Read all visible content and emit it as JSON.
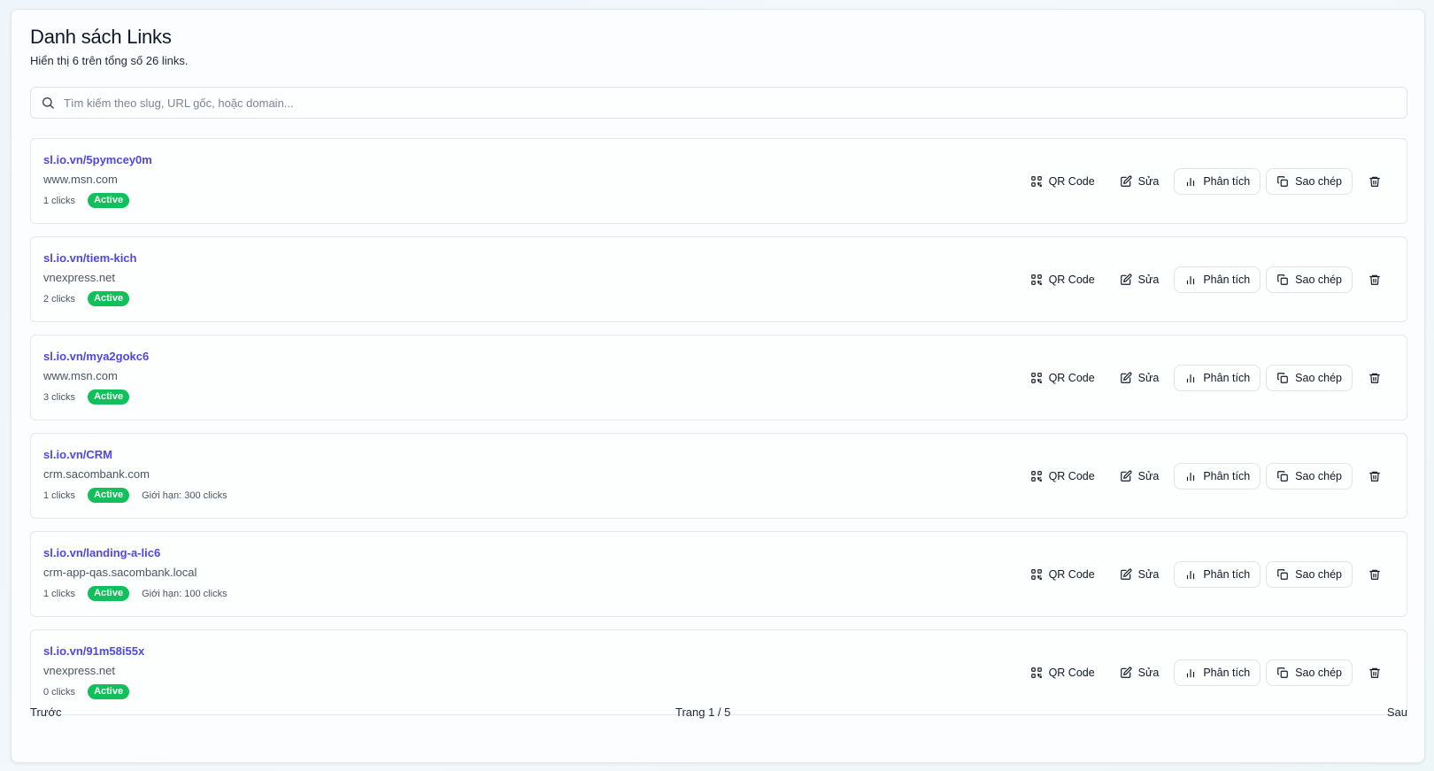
{
  "header": {
    "title": "Danh sách Links",
    "subtitle": "Hiển thị 6 trên tổng số 26 links."
  },
  "search": {
    "placeholder": "Tìm kiếm theo slug, URL gốc, hoặc domain...",
    "value": ""
  },
  "action_labels": {
    "qr": "QR Code",
    "edit": "Sửa",
    "analyze": "Phân tích",
    "copy": "Sao chép"
  },
  "colors": {
    "slug": "#4f46e5",
    "active_badge": "#10c05a"
  },
  "links": [
    {
      "short_url": "sl.io.vn/5pymcey0m",
      "destination": "www.msn.com",
      "clicks": "1 clicks",
      "status": "Active",
      "limit": ""
    },
    {
      "short_url": "sl.io.vn/tiem-kich",
      "destination": "vnexpress.net",
      "clicks": "2 clicks",
      "status": "Active",
      "limit": ""
    },
    {
      "short_url": "sl.io.vn/mya2gokc6",
      "destination": "www.msn.com",
      "clicks": "3 clicks",
      "status": "Active",
      "limit": ""
    },
    {
      "short_url": "sl.io.vn/CRM",
      "destination": "crm.sacombank.com",
      "clicks": "1 clicks",
      "status": "Active",
      "limit": "Giới hạn: 300 clicks"
    },
    {
      "short_url": "sl.io.vn/landing-a-lic6",
      "destination": "crm-app-qas.sacombank.local",
      "clicks": "1 clicks",
      "status": "Active",
      "limit": "Giới hạn: 100 clicks"
    },
    {
      "short_url": "sl.io.vn/91m58i55x",
      "destination": "vnexpress.net",
      "clicks": "0 clicks",
      "status": "Active",
      "limit": ""
    }
  ],
  "pagination": {
    "prev": "Trước",
    "info": "Trang 1 / 5",
    "next": "Sau"
  }
}
